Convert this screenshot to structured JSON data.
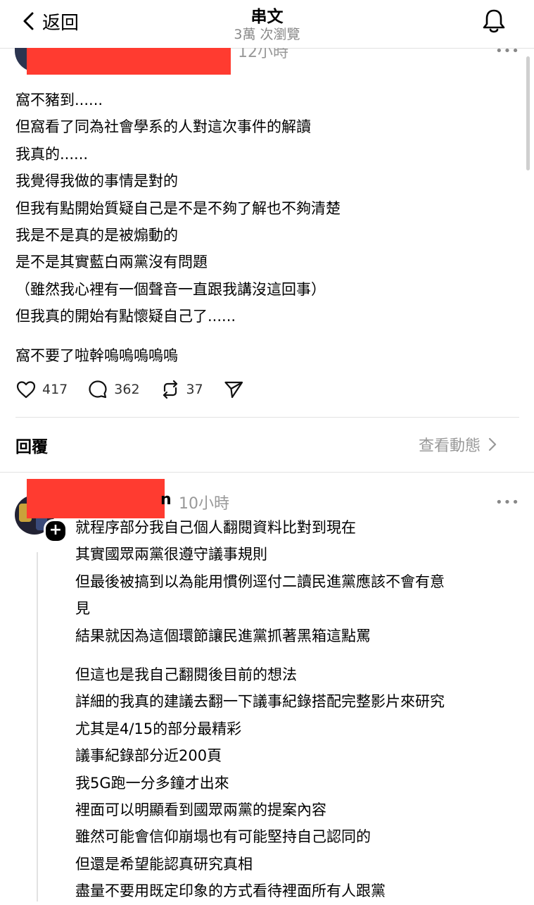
{
  "header": {
    "back_label": "返回",
    "title": "串文",
    "views": "3萬 次瀏覽"
  },
  "post": {
    "time": "12小時",
    "more": "•••",
    "paragraphs": [
      [
        "窩不豬到......",
        "但窩看了同為社會學系的人對這次事件的解讀",
        "我真的......",
        "我覺得我做的事情是對的",
        "但我有點開始質疑自己是不是不夠了解也不夠清楚",
        "我是不是真的是被煽動的",
        "是不是其實藍白兩黨沒有問題",
        "（雖然我心裡有一個聲音一直跟我講沒這回事）",
        "但我真的開始有點懷疑自己了......"
      ],
      [
        "窩不要了啦幹嗚嗚嗚嗚嗚"
      ]
    ],
    "actions": {
      "likes": "417",
      "comments": "362",
      "reposts": "37"
    }
  },
  "replies_section": {
    "title": "回覆",
    "activity_label": "查看動態"
  },
  "reply": {
    "name_fragment": "n",
    "time": "10小時",
    "more": "•••",
    "plus": "+",
    "paragraphs": [
      [
        "就程序部分我自己個人翻閱資料比對到現在",
        "其實國眾兩黨很遵守議事規則",
        "但最後被搞到以為能用慣例逕付二讀民進黨應該不會有意",
        "見",
        "結果就因為這個環節讓民進黨抓著黑箱這點罵"
      ],
      [
        "但這也是我自己翻閱後目前的想法",
        "詳細的我真的建議去翻一下議事紀錄搭配完整影片來研究",
        "尤其是4/15的部分最精彩",
        "議事紀錄部分近200頁",
        "我5G跑一分多鐘才出來",
        "裡面可以明顯看到國眾兩黨的提案內容",
        "雖然可能會信仰崩塌也有可能堅持自己認同的",
        "但還是希望能認真研究真相",
        "盡量不要用既定印象的方式看待裡面所有人跟黨"
      ]
    ]
  },
  "icons": {
    "back": "chevron-left-icon",
    "bell": "bell-icon",
    "like": "heart-icon",
    "comment": "comment-icon",
    "repost": "repost-icon",
    "share": "send-icon",
    "chevron": "chevron-right-icon"
  },
  "colors": {
    "redaction": "#ff3b30",
    "muted_text": "#999999",
    "divider": "#e2e2e2"
  }
}
